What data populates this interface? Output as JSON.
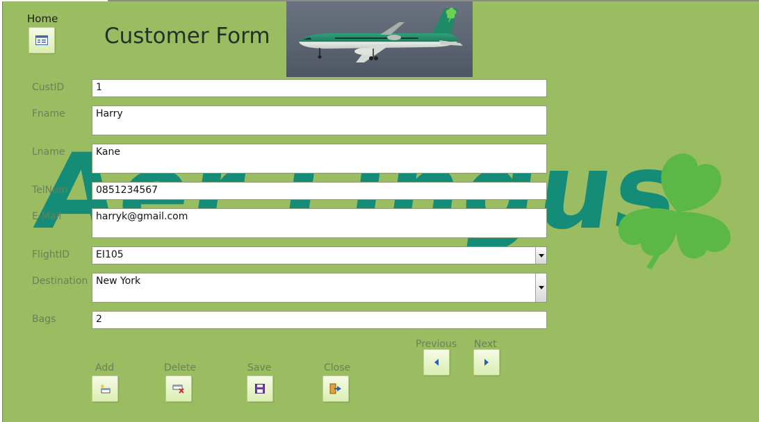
{
  "home": {
    "label": "Home",
    "icon": "form-icon"
  },
  "title": "Customer Form",
  "fields": {
    "custid": {
      "label": "CustID",
      "value": "1"
    },
    "fname": {
      "label": "Fname",
      "value": "Harry"
    },
    "lname": {
      "label": "Lname",
      "value": "Kane"
    },
    "telnum": {
      "label": "TelNum",
      "value": "0851234567"
    },
    "email": {
      "label": "E-Mail",
      "value": "harryk@gmail.com"
    },
    "flightid": {
      "label": "FlightID",
      "value": "EI105"
    },
    "destination": {
      "label": "Destination",
      "value": "New York"
    },
    "bags": {
      "label": "Bags",
      "value": "2"
    }
  },
  "buttons": {
    "add": "Add",
    "delete": "Delete",
    "save": "Save",
    "close": "Close",
    "previous": "Previous",
    "next": "Next"
  },
  "background_logo": {
    "text": "Aer Lingus",
    "color": "#0e8a7a",
    "shamrock_color": "#5bb845"
  },
  "colors": {
    "form_bg": "#9bbd62",
    "label": "#6c7f58",
    "title": "#233129"
  }
}
